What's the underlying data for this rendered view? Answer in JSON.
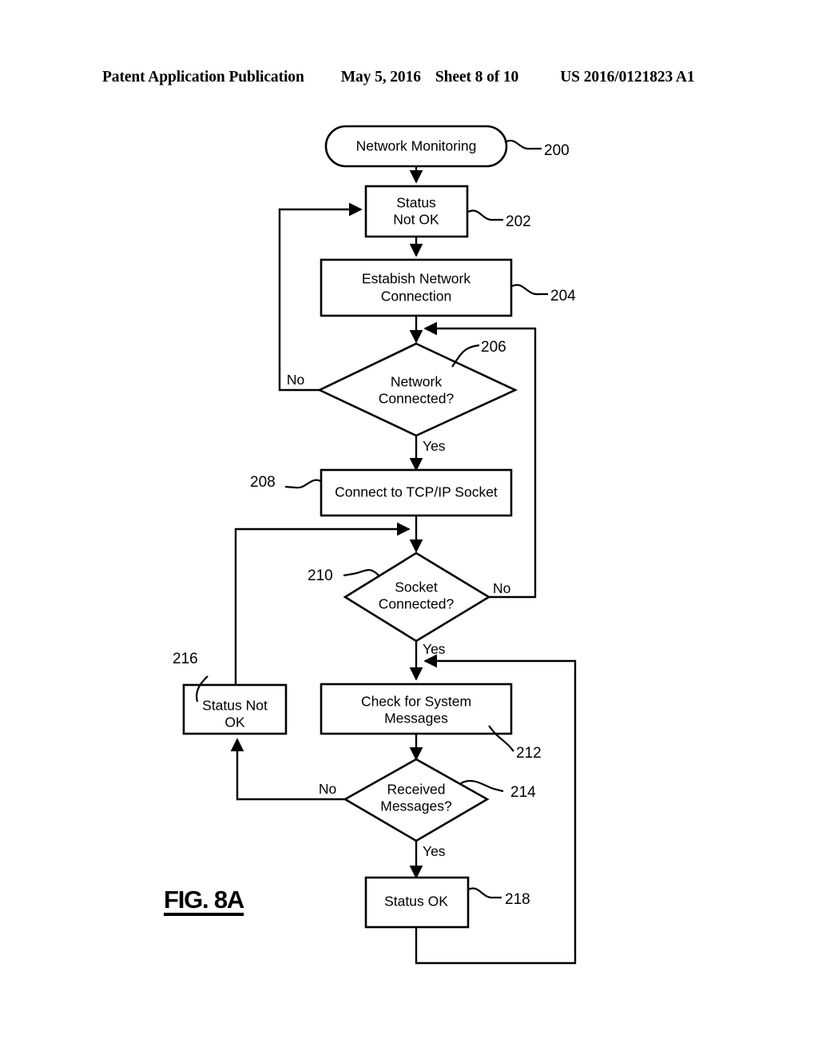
{
  "header": {
    "title": "Patent Application Publication",
    "date": "May 5, 2016",
    "sheet": "Sheet 8 of 10",
    "number": "US 2016/0121823 A1"
  },
  "figure": {
    "caption": "FIG. 8A",
    "type": "flowchart",
    "nodes": [
      {
        "ref": "200",
        "shape": "terminal",
        "line1": "Network Monitoring",
        "line2": ""
      },
      {
        "ref": "202",
        "shape": "process",
        "line1": "Status",
        "line2": "Not OK"
      },
      {
        "ref": "204",
        "shape": "process",
        "line1": "Estabish Network",
        "line2": "Connection"
      },
      {
        "ref": "206",
        "shape": "decision",
        "line1": "Network",
        "line2": "Connected?"
      },
      {
        "ref": "208",
        "shape": "process",
        "line1": "Connect to TCP/IP Socket",
        "line2": ""
      },
      {
        "ref": "210",
        "shape": "decision",
        "line1": "Socket",
        "line2": "Connected?"
      },
      {
        "ref": "212",
        "shape": "process",
        "line1": "Check for System",
        "line2": "Messages"
      },
      {
        "ref": "214",
        "shape": "decision",
        "line1": "Received",
        "line2": "Messages?"
      },
      {
        "ref": "216",
        "shape": "process",
        "line1": "Status Not",
        "line2": "OK"
      },
      {
        "ref": "218",
        "shape": "process",
        "line1": "Status OK",
        "line2": ""
      }
    ],
    "edge_labels": {
      "net_no": "No",
      "net_yes": "Yes",
      "sock_no": "No",
      "sock_yes": "Yes",
      "msg_no": "No",
      "msg_yes": "Yes"
    }
  }
}
